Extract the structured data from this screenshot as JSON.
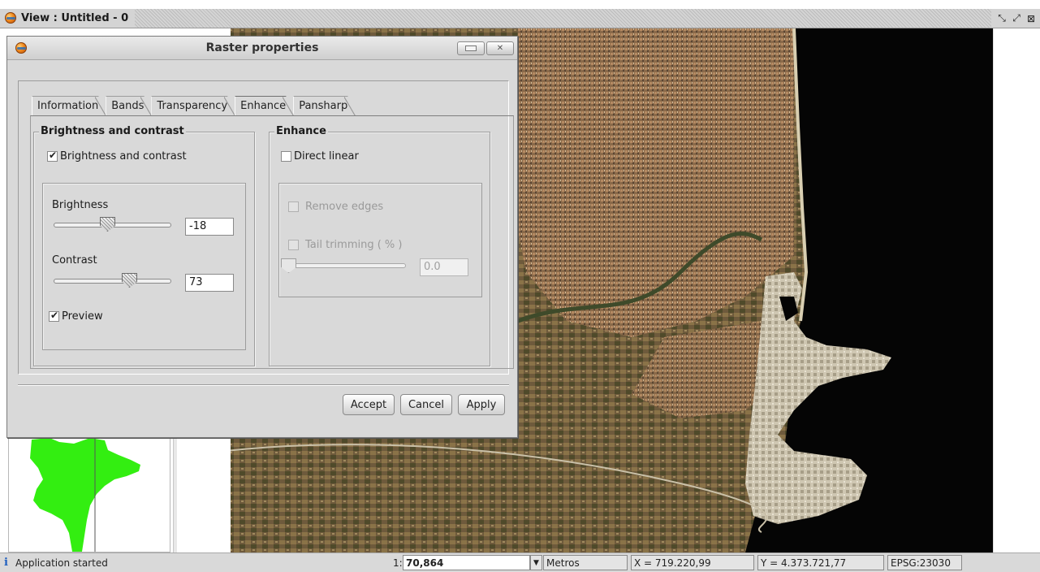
{
  "view": {
    "title": "View : Untitled - 0",
    "controls": [
      "⤡",
      "⤢",
      "⊠"
    ]
  },
  "dialog": {
    "title": "Raster properties",
    "tabs": [
      {
        "label": "Information",
        "active": false
      },
      {
        "label": "Bands",
        "active": false
      },
      {
        "label": "Transparency",
        "active": false
      },
      {
        "label": "Enhance",
        "active": true
      },
      {
        "label": "Pansharp",
        "active": false
      }
    ],
    "brightness_group": {
      "legend": "Brightness and contrast",
      "enable_label": "Brightness and contrast",
      "enable_checked": true,
      "brightness_label": "Brightness",
      "brightness_value": "-18",
      "brightness_level": 0.45,
      "contrast_label": "Contrast",
      "contrast_value": "73",
      "contrast_level": 0.65,
      "preview_label": "Preview",
      "preview_checked": true
    },
    "enhance_group": {
      "legend": "Enhance",
      "direct_linear_label": "Direct linear",
      "direct_linear_checked": false,
      "remove_edges_label": "Remove edges",
      "tail_trimming_label": "Tail trimming ( % )",
      "tail_trimming_value": "0.0"
    },
    "buttons": {
      "accept": "Accept",
      "cancel": "Cancel",
      "apply": "Apply"
    }
  },
  "status": {
    "message": "Application started",
    "scale_prefix": "1:",
    "scale_value": "70,864",
    "units": "Metros",
    "x_coord": "X = 719.220,99",
    "y_coord": "Y = 4.373.721,77",
    "epsg": "EPSG:23030"
  },
  "colors": {
    "overview_land": "#33ee11",
    "sea": "#050505"
  }
}
